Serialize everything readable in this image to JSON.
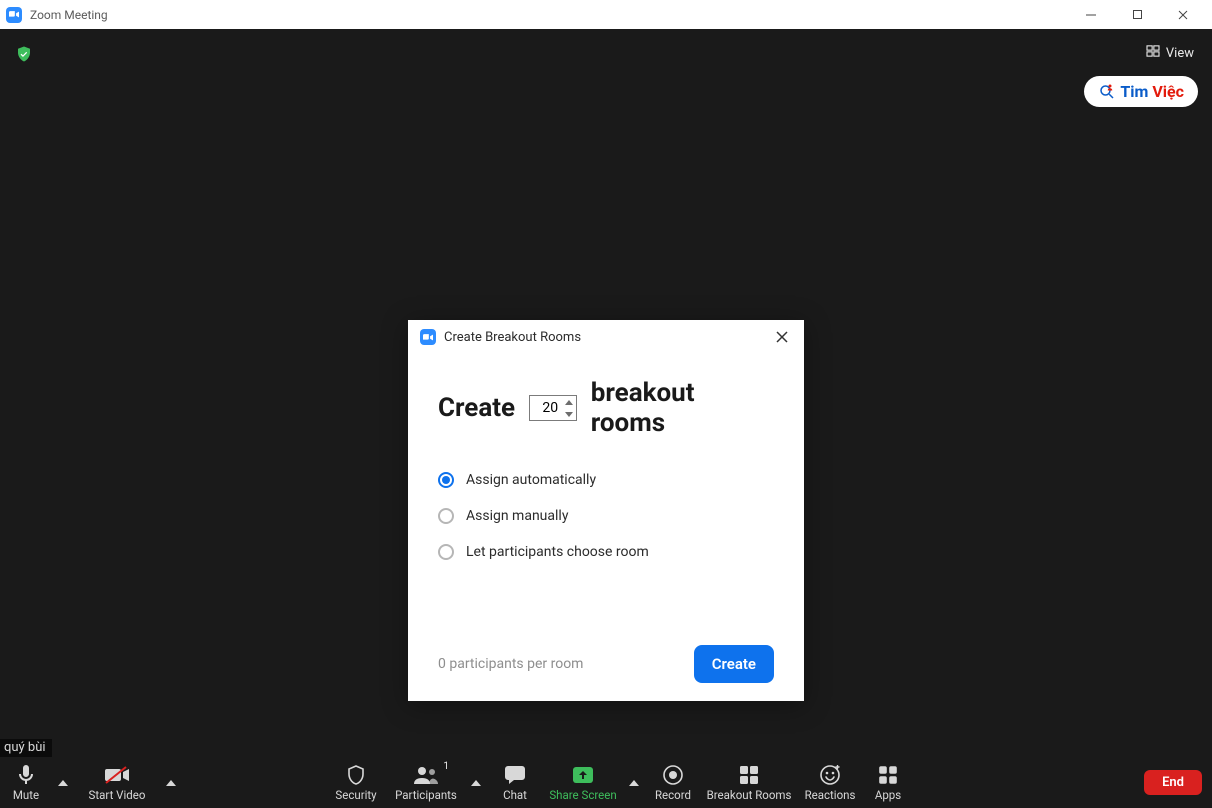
{
  "window": {
    "title": "Zoom Meeting"
  },
  "topbar": {
    "view_label": "View"
  },
  "watermark": {
    "part1": "Tim",
    "part2": "Việc"
  },
  "participant_tag": "quý bùi",
  "dialog": {
    "title": "Create Breakout Rooms",
    "create_prefix": "Create",
    "create_suffix": "breakout rooms",
    "room_count": "20",
    "options": {
      "auto": "Assign automatically",
      "manual": "Assign manually",
      "choose": "Let participants choose room"
    },
    "selected_option": "auto",
    "per_room_text": "0 participants per room",
    "create_button": "Create"
  },
  "toolbar": {
    "mute": "Mute",
    "start_video": "Start Video",
    "security": "Security",
    "participants": "Participants",
    "participants_count": "1",
    "chat": "Chat",
    "share_screen": "Share Screen",
    "record": "Record",
    "breakout_rooms": "Breakout Rooms",
    "reactions": "Reactions",
    "apps": "Apps",
    "end": "End"
  }
}
